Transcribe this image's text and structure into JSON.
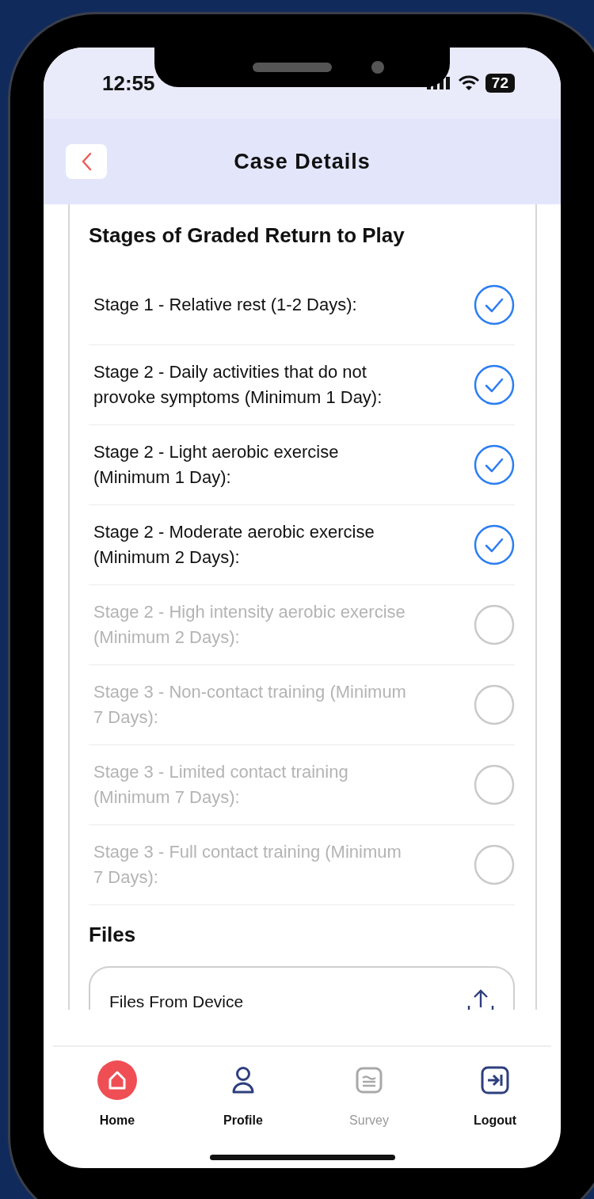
{
  "status_bar": {
    "time": "12:55",
    "battery": "72"
  },
  "header": {
    "title": "Case Details"
  },
  "stages": {
    "title": "Stages of Graded Return to Play",
    "items": [
      {
        "label": "Stage 1 - Relative rest (1-2 Days):",
        "checked": true,
        "disabled": false
      },
      {
        "label": "Stage 2 - Daily activities that do not provoke symptoms (Minimum 1 Day):",
        "checked": true,
        "disabled": false
      },
      {
        "label": "Stage 2 - Light aerobic exercise (Minimum 1 Day):",
        "checked": true,
        "disabled": false
      },
      {
        "label": "Stage 2 - Moderate aerobic exercise (Minimum 2 Days):",
        "checked": true,
        "disabled": false
      },
      {
        "label": "Stage 2 - High intensity aerobic exercise (Minimum 2 Days):",
        "checked": false,
        "disabled": true
      },
      {
        "label": "Stage 3 - Non-contact training (Minimum 7 Days):",
        "checked": false,
        "disabled": true
      },
      {
        "label": "Stage 3 - Limited contact training (Minimum 7 Days):",
        "checked": false,
        "disabled": true
      },
      {
        "label": "Stage 3 - Full contact training (Minimum 7 Days):",
        "checked": false,
        "disabled": true
      }
    ]
  },
  "files": {
    "title": "Files",
    "upload_label": "Files From Device"
  },
  "tab_bar": [
    {
      "kind": "home",
      "label": "Home",
      "selected": true,
      "disabled": false
    },
    {
      "kind": "profile",
      "label": "Profile",
      "selected": false,
      "disabled": false
    },
    {
      "kind": "survey",
      "label": "Survey",
      "selected": false,
      "disabled": true
    },
    {
      "kind": "logout",
      "label": "Logout",
      "selected": false,
      "disabled": false
    }
  ]
}
